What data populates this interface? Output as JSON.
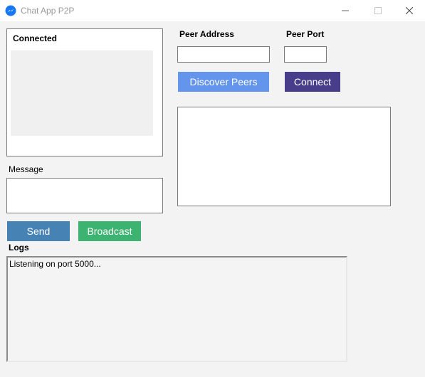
{
  "window": {
    "title": "Chat App P2P",
    "icon": "messenger-icon",
    "controls": [
      "minimize-icon",
      "maximize-icon",
      "close-icon"
    ]
  },
  "connected": {
    "label": "Connected"
  },
  "message": {
    "label": "Message",
    "value": ""
  },
  "peer": {
    "address_label": "Peer Address",
    "address_value": "",
    "port_label": "Peer Port",
    "port_value": ""
  },
  "buttons": {
    "discover": "Discover Peers",
    "connect": "Connect",
    "send": "Send",
    "broadcast": "Broadcast"
  },
  "logs": {
    "label": "Logs",
    "content": "Listening on port 5000..."
  },
  "colors": {
    "discover_bg": "#6495ed",
    "connect_bg": "#483d8b",
    "send_bg": "#4682b4",
    "broadcast_bg": "#3cb371"
  }
}
